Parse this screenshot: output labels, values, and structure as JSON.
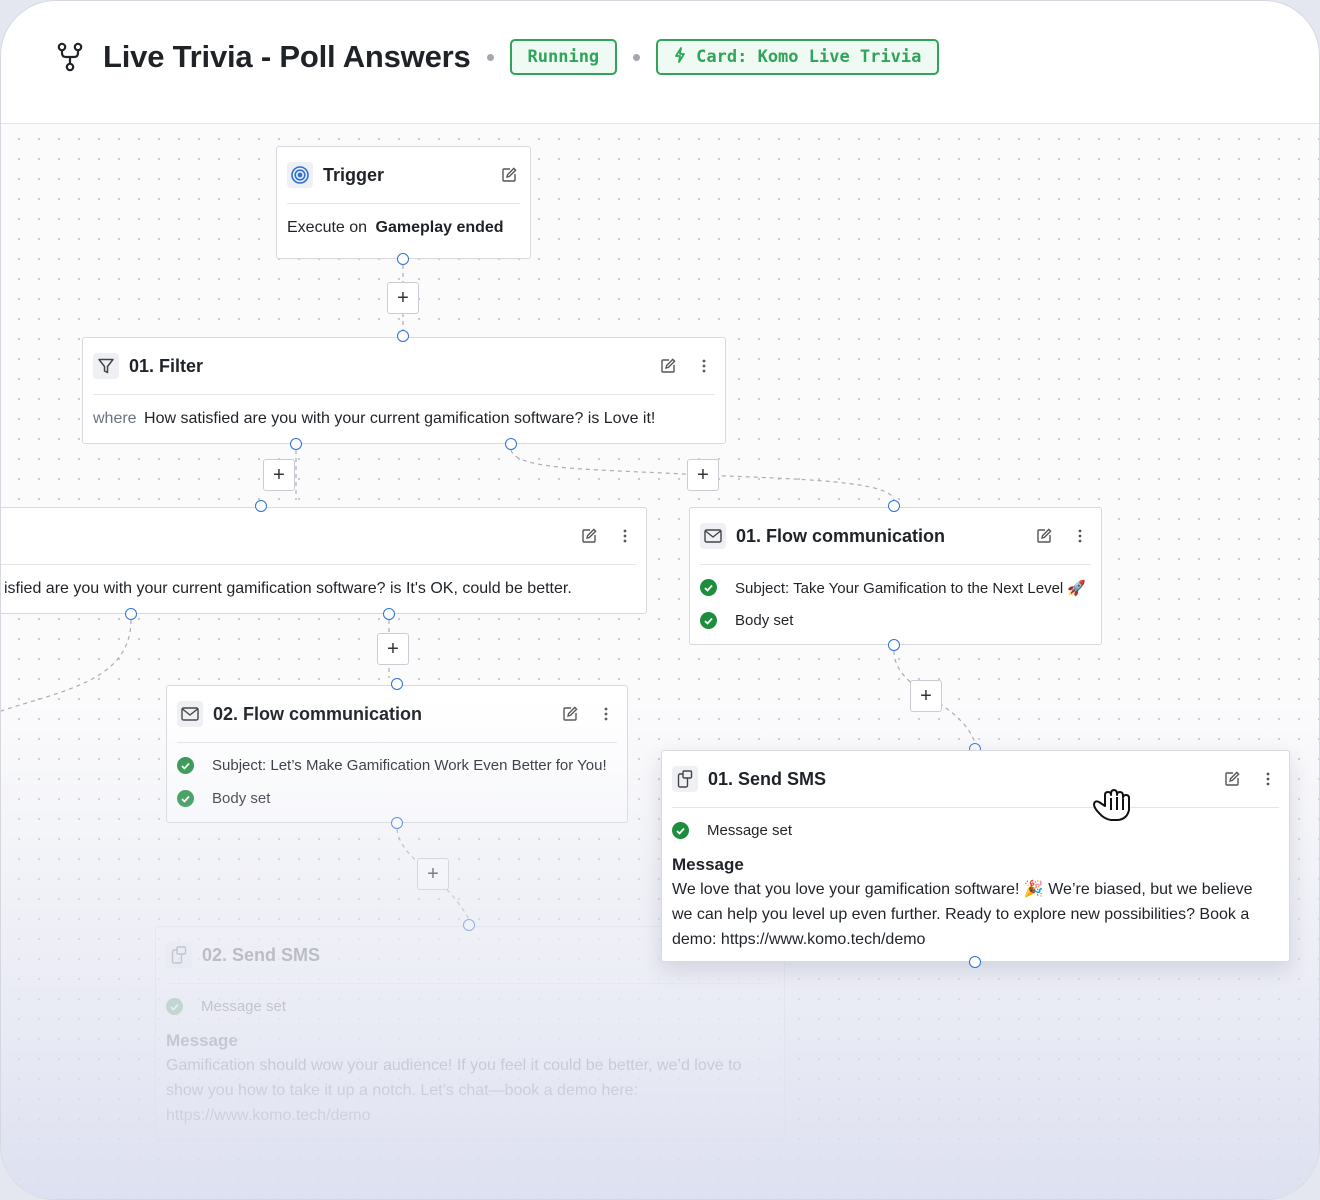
{
  "header": {
    "title": "Live Trivia - Poll Answers",
    "status_badge": "Running",
    "card_badge": "Card: Komo Live Trivia"
  },
  "nodes": {
    "trigger": {
      "title": "Trigger",
      "prefix": "Execute on",
      "event": "Gameplay ended"
    },
    "filter_01": {
      "title": "01. Filter",
      "where": "where",
      "condition": "How satisfied are you with your current gamification software? is Love it!"
    },
    "filter_02": {
      "condition": "isfied are you with your current gamification software? is It's OK, could be better."
    },
    "flow_comm_01": {
      "title": "01. Flow communication",
      "subject": "Subject: Take Your Gamification to the Next Level 🚀",
      "body": "Body set"
    },
    "flow_comm_02": {
      "title": "02. Flow communication",
      "subject": "Subject: Let’s Make Gamification Work Even Better for You!",
      "body": "Body set"
    },
    "send_sms_01": {
      "title": "01. Send SMS",
      "status": "Message set",
      "message_label": "Message",
      "message": "We love that you love your gamification software! 🎉 We’re biased, but we believe we can help you level up even further. Ready to explore new possibilities? Book a demo: https://www.komo.tech/demo"
    },
    "send_sms_02": {
      "title": "02. Send SMS",
      "status": "Message set",
      "message_label": "Message",
      "message": "Gamification should wow your audience! If you feel it could be better, we’d love to show you how to take it up a notch. Let’s chat—book a demo here: https://www.komo.tech/demo"
    }
  },
  "controls": {
    "add_symbol": "+"
  },
  "icons": {
    "workflow": "branch-icon",
    "trigger": "target-icon",
    "filter": "funnel-icon",
    "email": "envelope-icon",
    "sms": "message-device-icon",
    "edit": "pencil-icon",
    "more": "vertical-dots-icon",
    "cursor": "grab-hand-icon"
  },
  "colors": {
    "accent": "#2d6fd8",
    "success": "#2fa45a",
    "check": "#1e8e3e"
  }
}
